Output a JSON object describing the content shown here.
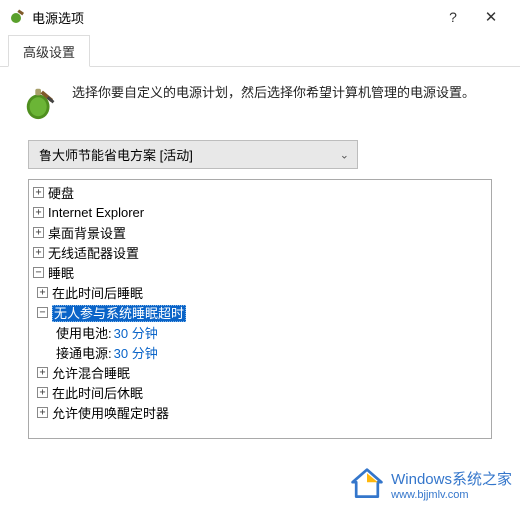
{
  "titlebar": {
    "title": "电源选项",
    "help_glyph": "?",
    "close_glyph": "✕"
  },
  "tab": {
    "label": "高级设置"
  },
  "description": "选择你要自定义的电源计划，然后选择你希望计算机管理的电源设置。",
  "plan": {
    "label": "鲁大师节能省电方案 [活动]"
  },
  "tree": {
    "items": [
      {
        "expander": "+",
        "label": "硬盘"
      },
      {
        "expander": "+",
        "label": "Internet Explorer"
      },
      {
        "expander": "+",
        "label": "桌面背景设置"
      },
      {
        "expander": "+",
        "label": "无线适配器设置"
      },
      {
        "expander": "−",
        "label": "睡眠",
        "children": [
          {
            "expander": "+",
            "label": "在此时间后睡眠"
          },
          {
            "expander": "−",
            "label": "无人参与系统睡眠超时",
            "selected": true,
            "children": [
              {
                "label_prefix": "使用电池:",
                "value": "30 分钟"
              },
              {
                "label_prefix": "接通电源:",
                "value": "30 分钟"
              }
            ]
          },
          {
            "expander": "+",
            "label": "允许混合睡眠"
          },
          {
            "expander": "+",
            "label": "在此时间后休眠"
          },
          {
            "expander": "+",
            "label": "允许使用唤醒定时器"
          }
        ]
      }
    ]
  },
  "watermark": {
    "brand": "Windows",
    "suffix": "系统之家",
    "url": "www.bjjmlv.com"
  }
}
